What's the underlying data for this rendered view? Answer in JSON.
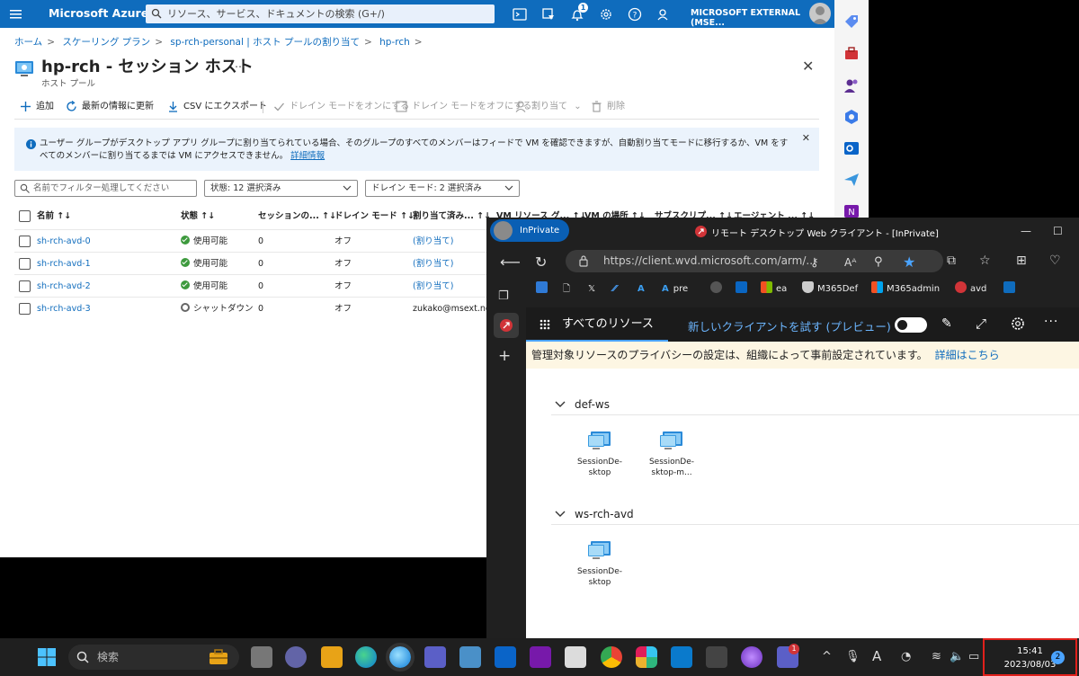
{
  "azure": {
    "brand": "Microsoft Azure",
    "search_placeholder": "リソース、サービス、ドキュメントの検索 (G+/)",
    "notification_count": "1",
    "account": "MICROSOFT EXTERNAL (MSE...",
    "breadcrumb": [
      "ホーム",
      "スケーリング プラン",
      "sp-rch-personal | ホスト プールの割り当て",
      "hp-rch"
    ],
    "title": "hp-rch - セッション ホスト",
    "subtitle": "ホスト プール",
    "ellipsis": "…",
    "commands": {
      "add": "追加",
      "refresh": "最新の情報に更新",
      "export": "CSV にエクスポート",
      "drain_on": "ドレイン モードをオンにする",
      "drain_off": "ドレイン モードをオフにする",
      "assign": "割り当て",
      "delete": "削除"
    },
    "info": {
      "text": "ユーザー グループがデスクトップ アプリ グループに割り当てられている場合、そのグループのすべてのメンバーはフィードで VM を確認できますが、自動割り当てモードに移行するか、VM をすべてのメンバーに割り当てるまでは VM にアクセスできません。",
      "link": "詳細情報"
    },
    "filters": {
      "name_placeholder": "名前でフィルター処理してください",
      "state": "状態: 12 選択済み",
      "drain": "ドレイン モード: 2 選択済み"
    },
    "columns": [
      "名前 ↑↓",
      "状態 ↑↓",
      "セッションの... ↑↓",
      "ドレイン モード ↑↓",
      "割り当て済み... ↑↓",
      "VM リソース グ... ↑↓",
      "VM の場所 ↑↓",
      "サブスクリプ... ↑↓",
      "エージェント ... ↑↓"
    ],
    "rows": [
      {
        "name": "sh-rch-avd-0",
        "state": "使用可能",
        "sessions": "0",
        "drain": "オフ",
        "assigned": "(割り当て)",
        "ok": true
      },
      {
        "name": "sh-rch-avd-1",
        "state": "使用可能",
        "sessions": "0",
        "drain": "オフ",
        "assigned": "(割り当て)",
        "ok": true
      },
      {
        "name": "sh-rch-avd-2",
        "state": "使用可能",
        "sessions": "0",
        "drain": "オフ",
        "assigned": "(割り当て)",
        "ok": true
      },
      {
        "name": "sh-rch-avd-3",
        "state": "シャットダウン",
        "sessions": "0",
        "drain": "オフ",
        "assigned": "zukako@msext.ne",
        "ok": false
      }
    ]
  },
  "edge": {
    "inprivate": "InPrivate",
    "window_title": "リモート デスクトップ Web クライアント - [InPrivate]",
    "url": "https://client.wvd.microsoft.com/arm/...",
    "favorites": [
      "pre",
      "ea",
      "M365Def",
      "M365admin",
      "avd"
    ],
    "tab_all": "すべてのリソース",
    "preview_link": "新しいクライアントを試す (プレビュー)",
    "notice": "管理対象リソースのプライバシーの設定は、組織によって事前設定されています。",
    "notice_link": "詳細はこちら",
    "groups": [
      {
        "name": "def-ws",
        "items": [
          [
            "SessionDe-",
            "sktop"
          ],
          [
            "SessionDe-",
            "sktop-m..."
          ]
        ]
      },
      {
        "name": "ws-rch-avd",
        "items": [
          [
            "SessionDe-",
            "sktop"
          ]
        ]
      }
    ]
  },
  "taskbar": {
    "search": "検索",
    "teams_badge": "1",
    "time": "15:41",
    "date": "2023/08/03",
    "notifications": "2",
    "ime": "A"
  },
  "colors": {
    "azure_blue": "#0f6cbd",
    "clock_highlight": "#e0201b"
  }
}
